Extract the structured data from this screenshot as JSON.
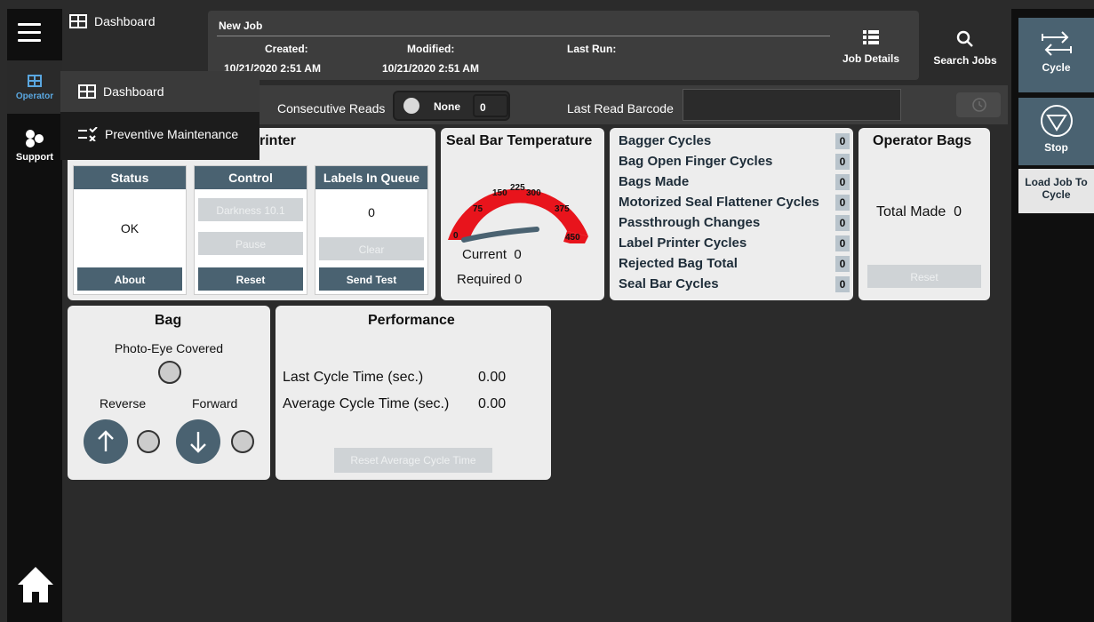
{
  "nav": {
    "operator_label": "Operator",
    "support_label": "Support",
    "dashboard_label": "Dashboard"
  },
  "menu": {
    "items": [
      "Dashboard",
      "Preventive Maintenance"
    ]
  },
  "job": {
    "name": "New Job",
    "created_label": "Created:",
    "created_value": "10/21/2020 2:51 AM",
    "modified_label": "Modified:",
    "modified_value": "10/21/2020 2:51 AM",
    "last_run_label": "Last Run:",
    "job_details_label": "Job Details",
    "search_jobs_label": "Search Jobs"
  },
  "reads": {
    "consecutive_label": "Consecutive Reads",
    "toggle_value": "None",
    "count": "0",
    "last_read_label": "Last Read Barcode",
    "last_read_value": ""
  },
  "printer": {
    "title": "rinter",
    "status_header": "Status",
    "status_value": "OK",
    "about_label": "About",
    "control_header": "Control",
    "darkness_label": "Darkness 10.1",
    "pause_label": "Pause",
    "reset_label": "Reset",
    "queue_header": "Labels In Queue",
    "queue_value": "0",
    "clear_label": "Clear",
    "send_test_label": "Send Test"
  },
  "seal": {
    "title": "Seal Bar Temperature",
    "current_label": "Current",
    "current_value": "0",
    "required_label": "Required",
    "required_value": "0",
    "gauge_ticks": [
      "0",
      "75",
      "150",
      "225",
      "300",
      "375",
      "450"
    ],
    "gauge_color": "#e8141c"
  },
  "stats": [
    {
      "label": "Bagger Cycles",
      "value": "0"
    },
    {
      "label": "Bag Open Finger Cycles",
      "value": "0"
    },
    {
      "label": "Bags Made",
      "value": "0"
    },
    {
      "label": "Motorized Seal Flattener Cycles",
      "value": "0"
    },
    {
      "label": "Passthrough Changes",
      "value": "0"
    },
    {
      "label": "Label Printer Cycles",
      "value": "0"
    },
    {
      "label": "Rejected Bag Total",
      "value": "0"
    },
    {
      "label": "Seal Bar Cycles",
      "value": "0"
    }
  ],
  "operator_bags": {
    "title": "Operator Bags",
    "total_label": "Total Made",
    "total_value": "0",
    "reset_label": "Reset"
  },
  "bag": {
    "title": "Bag",
    "photo_eye_label": "Photo-Eye Covered",
    "reverse_label": "Reverse",
    "forward_label": "Forward"
  },
  "performance": {
    "title": "Performance",
    "last_label": "Last Cycle Time (sec.)",
    "last_value": "0.00",
    "avg_label": "Average Cycle Time (sec.)",
    "avg_value": "0.00",
    "reset_label": "Reset Average Cycle Time"
  },
  "right": {
    "cycle_label": "Cycle",
    "stop_label": "Stop",
    "load_label": "Load Job To Cycle"
  },
  "colors": {
    "accent": "#4a6271",
    "operator_blue": "#5aa7e0"
  }
}
